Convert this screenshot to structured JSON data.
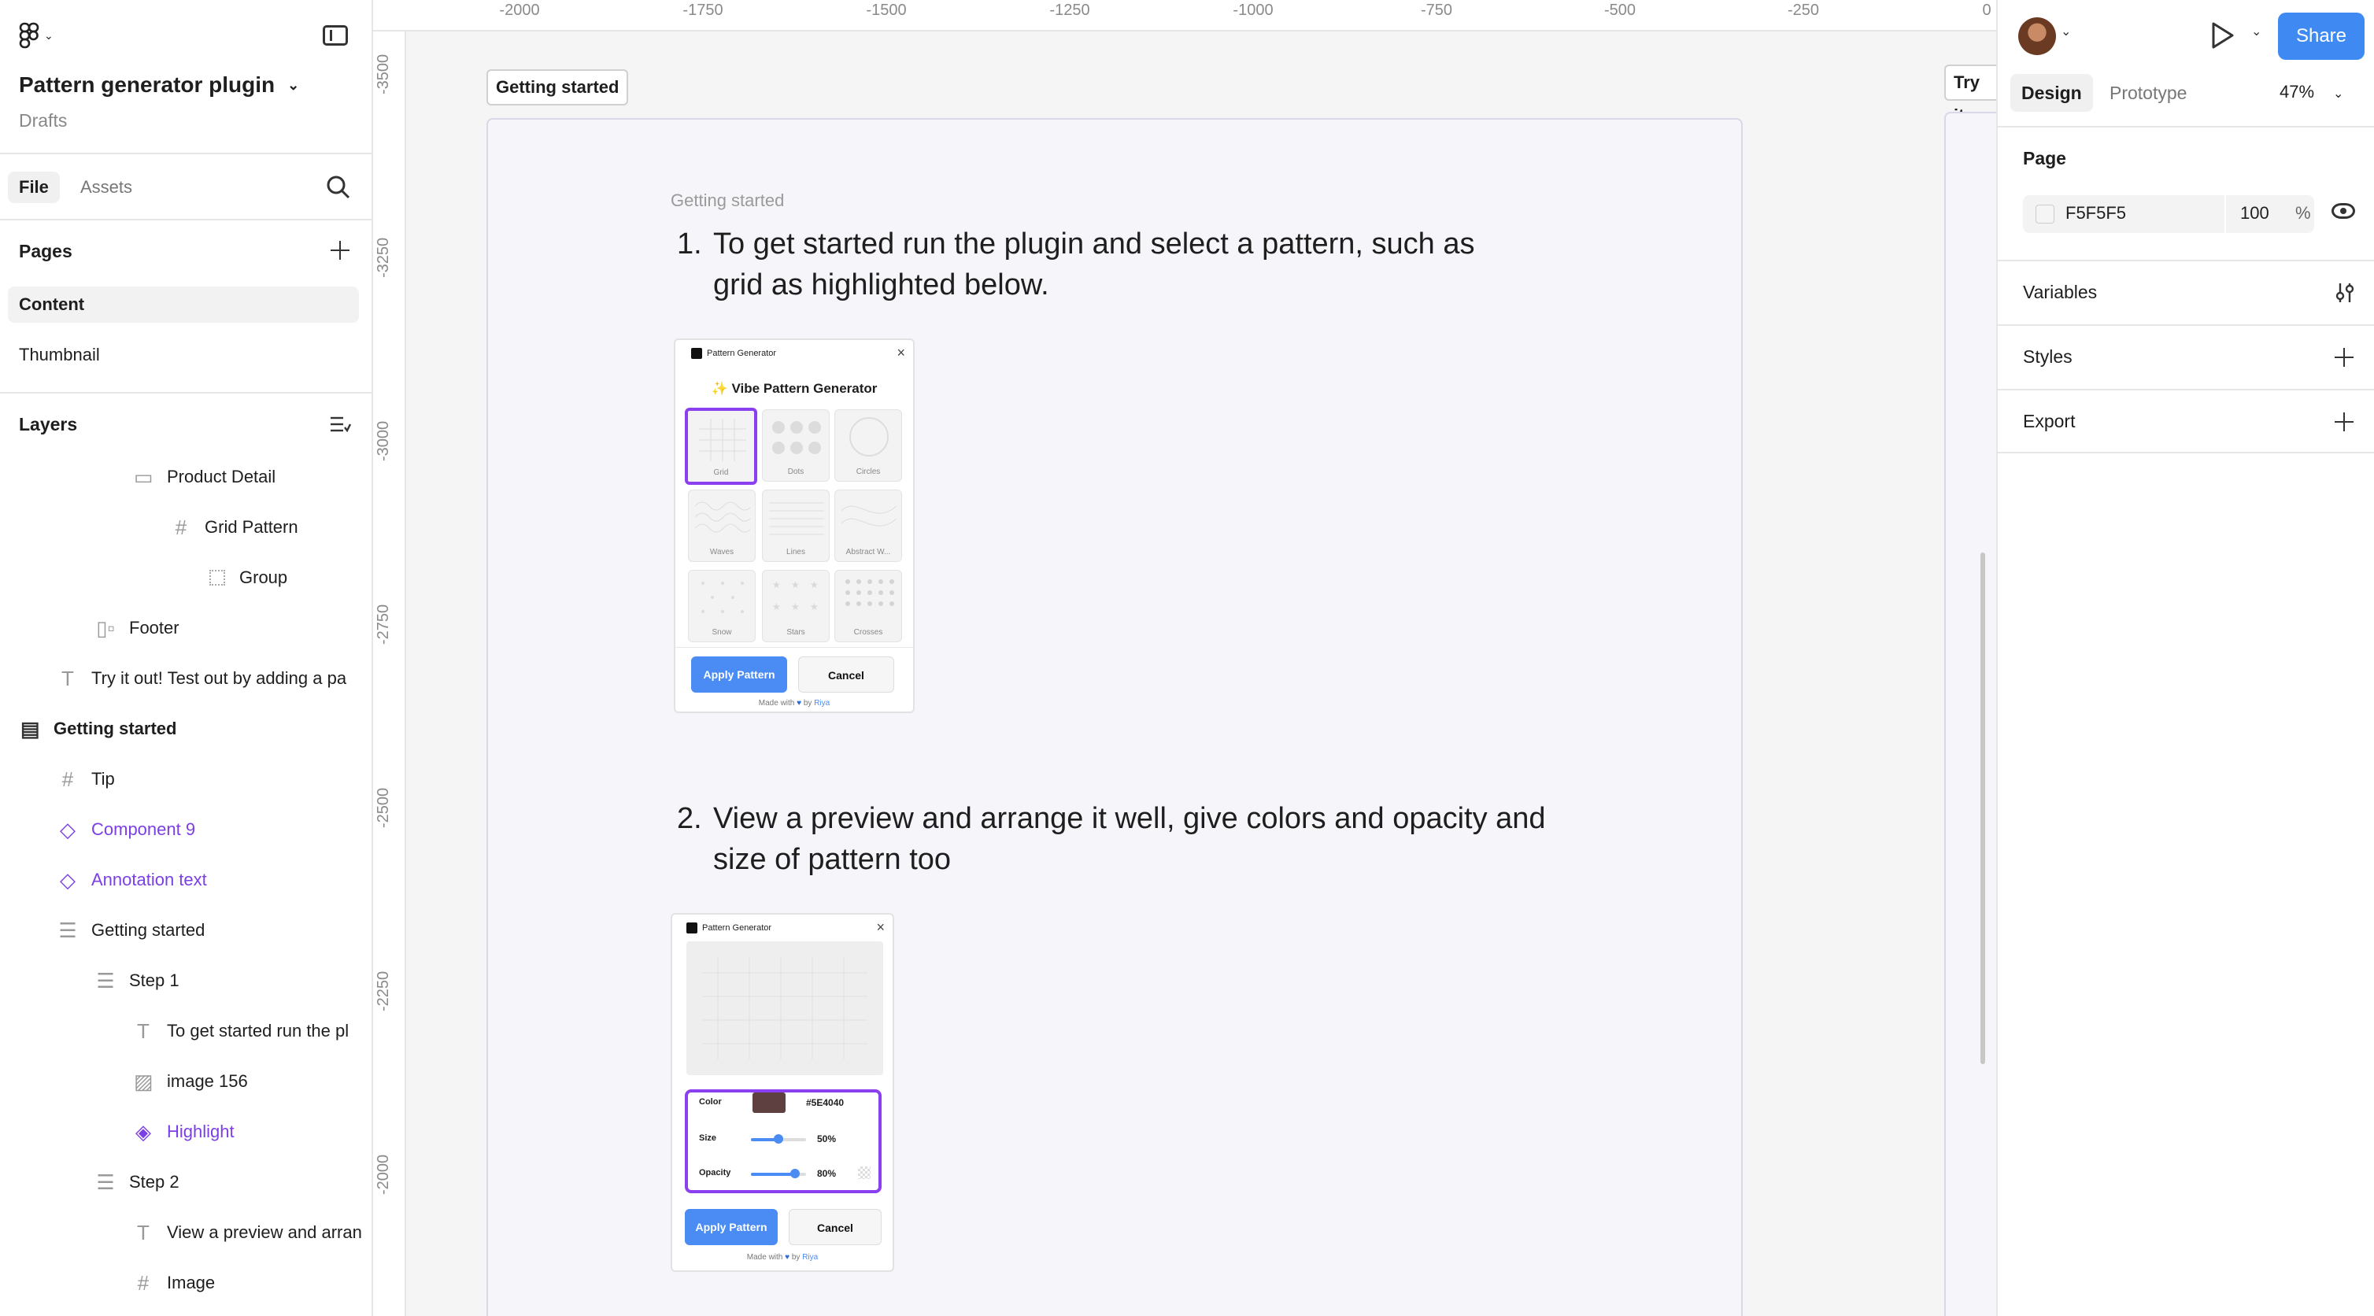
{
  "left_panel": {
    "project_title": "Pattern generator plugin",
    "project_location": "Drafts",
    "tabs": {
      "file": "File",
      "assets": "Assets"
    },
    "pages_heading": "Pages",
    "pages": [
      "Content",
      "Thumbnail"
    ],
    "layers_heading": "Layers",
    "layers": [
      {
        "label": "Product Detail",
        "icon": "section-icon"
      },
      {
        "label": "Grid Pattern",
        "icon": "frame-icon"
      },
      {
        "label": "Group",
        "icon": "group-icon"
      },
      {
        "label": "Footer",
        "icon": "autolayout-icon"
      },
      {
        "label": "Try it out! Test out by adding a pa",
        "icon": "text-icon"
      },
      {
        "label": "Getting started",
        "icon": "section-icon"
      },
      {
        "label": "Tip",
        "icon": "frame-icon"
      },
      {
        "label": "Component 9",
        "icon": "component-icon"
      },
      {
        "label": "Annotation text",
        "icon": "component-icon"
      },
      {
        "label": "Getting started",
        "icon": "autolayout-icon"
      },
      {
        "label": "Step 1",
        "icon": "autolayout-icon"
      },
      {
        "label": "To get started run the pl",
        "icon": "text-icon"
      },
      {
        "label": "image 156",
        "icon": "image-icon"
      },
      {
        "label": "Highlight",
        "icon": "instance-icon"
      },
      {
        "label": "Step 2",
        "icon": "autolayout-icon"
      },
      {
        "label": "View a preview and arran",
        "icon": "text-icon"
      },
      {
        "label": "Image",
        "icon": "frame-icon"
      }
    ]
  },
  "rulers": {
    "top": [
      "-2000",
      "-1750",
      "-1500",
      "-1250",
      "-1000",
      "-750",
      "-500",
      "-250",
      "0"
    ],
    "left": [
      "-3500",
      "-3250",
      "-3000",
      "-2750",
      "-2500",
      "-2250",
      "-2000"
    ]
  },
  "canvas": {
    "frame_label": "Getting started",
    "frame_label_right": "Try it",
    "caption": "Getting started",
    "step1": {
      "num": "1.",
      "line1": "To get started run the plugin and select a pattern, such as",
      "line2": "grid as highlighted below."
    },
    "step2": {
      "num": "2.",
      "line1": "View a preview and arrange it well, give colors and opacity and",
      "line2": "size of pattern too"
    },
    "plugin1": {
      "window_title": "Pattern Generator",
      "heading": "✨ Vibe Pattern Generator",
      "patterns": [
        "Grid",
        "Dots",
        "Circles",
        "Waves",
        "Lines",
        "Abstract W...",
        "Snow",
        "Stars",
        "Crosses"
      ],
      "apply_label": "Apply Pattern",
      "cancel_label": "Cancel",
      "footer_pre": "Made with",
      "footer_by": "by",
      "footer_brand": "Riya"
    },
    "plugin2": {
      "window_title": "Pattern Generator",
      "color_label": "Color",
      "color_hex": "#5E4040",
      "size_label": "Size",
      "size_value": "50%",
      "size_fraction": 0.5,
      "opacity_label": "Opacity",
      "opacity_value": "80%",
      "opacity_fraction": 0.8,
      "apply_label": "Apply Pattern",
      "cancel_label": "Cancel",
      "footer_pre": "Made with",
      "footer_by": "by",
      "footer_brand": "Riya"
    }
  },
  "right_panel": {
    "share_label": "Share",
    "tabs": {
      "design": "Design",
      "prototype": "Prototype"
    },
    "zoom": "47%",
    "page_heading": "Page",
    "page_color": "F5F5F5",
    "page_opacity": "100",
    "percent_sign": "%",
    "variables_label": "Variables",
    "styles_label": "Styles",
    "export_label": "Export"
  },
  "colors": {
    "accent": "#3E8AF2",
    "highlight": "#8A3FF0",
    "component": "#7B3FE4",
    "swatch": "#5E4040"
  }
}
